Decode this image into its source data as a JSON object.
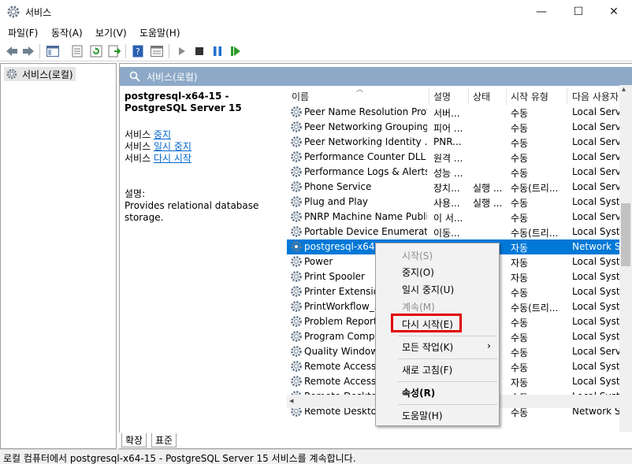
{
  "window": {
    "title": "서비스",
    "minimize": "—",
    "maximize": "☐",
    "close": "✕"
  },
  "menu": [
    "파일(F)",
    "동작(A)",
    "보기(V)",
    "도움말(H)"
  ],
  "tree": {
    "root": "서비스(로컬)"
  },
  "pane": {
    "header": "서비스(로컬)"
  },
  "details": {
    "title": "postgresql-x64-15 - PostgreSQL Server 15",
    "line1_prefix": "서비스",
    "line1_link": "중지",
    "line2_prefix": "서비스",
    "line2_link": "일시 중지",
    "line3_prefix": "서비스",
    "line3_link": "다시 시작",
    "desc_label": "설명:",
    "desc_text": "Provides relational database storage."
  },
  "columns": [
    "이름",
    "설명",
    "상태",
    "시작 유형",
    "다음 사용자"
  ],
  "rows": [
    {
      "name": "Peer Name Resolution Prot...",
      "desc": "서버...",
      "status": "",
      "start": "수동",
      "user": "Local Service"
    },
    {
      "name": "Peer Networking Grouping",
      "desc": "피어 ...",
      "status": "",
      "start": "수동",
      "user": "Local Service"
    },
    {
      "name": "Peer Networking Identity ...",
      "desc": "PNR...",
      "status": "",
      "start": "수동",
      "user": "Local Service"
    },
    {
      "name": "Performance Counter DLL ...",
      "desc": "원격 ...",
      "status": "",
      "start": "수동",
      "user": "Local Service"
    },
    {
      "name": "Performance Logs & Alerts",
      "desc": "성능 ...",
      "status": "",
      "start": "수동",
      "user": "Local Service"
    },
    {
      "name": "Phone Service",
      "desc": "장치...",
      "status": "실행 ...",
      "start": "수동(트리...",
      "user": "Local Service"
    },
    {
      "name": "Plug and Play",
      "desc": "사용...",
      "status": "실행 ...",
      "start": "수동",
      "user": "Local System"
    },
    {
      "name": "PNRP Machine Name Publi...",
      "desc": "이 서...",
      "status": "",
      "start": "수동",
      "user": "Local Service"
    },
    {
      "name": "Portable Device Enumerato...",
      "desc": "이동...",
      "status": "",
      "start": "수동(트리...",
      "user": "Local System"
    },
    {
      "name": "postgresql-x64-15",
      "desc": "",
      "status": "",
      "start": "자동",
      "user": "Network Se"
    },
    {
      "name": "Power",
      "desc": "",
      "status": "",
      "start": "자동",
      "user": "Local System"
    },
    {
      "name": "Print Spooler",
      "desc": "",
      "status": "",
      "start": "자동",
      "user": "Local System"
    },
    {
      "name": "Printer Extension",
      "desc": "",
      "status": "",
      "start": "수동",
      "user": "Local System"
    },
    {
      "name": "PrintWorkflow_3",
      "desc": "",
      "status": "",
      "start": "수동(트리...",
      "user": "Local System"
    },
    {
      "name": "Problem Reports",
      "desc": "",
      "status": "",
      "start": "수동",
      "user": "Local System"
    },
    {
      "name": "Program Compa",
      "desc": "",
      "status": "",
      "start": "수동",
      "user": "Local System"
    },
    {
      "name": "Quality Windows",
      "desc": "",
      "status": "",
      "start": "수동",
      "user": "Local Service"
    },
    {
      "name": "Remote Access A",
      "desc": "",
      "status": "",
      "start": "수동",
      "user": "Local System"
    },
    {
      "name": "Remote Access C",
      "desc": "",
      "status": "",
      "start": "자동",
      "user": "Local System"
    },
    {
      "name": "Remote Desktop",
      "desc": "",
      "status": "",
      "start": "수동",
      "user": "Local System"
    },
    {
      "name": "Remote Desktop",
      "desc": "",
      "status": "",
      "start": "수동",
      "user": "Network Se"
    }
  ],
  "context_menu": {
    "start": "시작(S)",
    "stop": "중지(O)",
    "pause": "일시 중지(U)",
    "resume": "계속(M)",
    "restart": "다시 시작(E)",
    "all_tasks": "모든 작업(K)",
    "refresh": "새로 고침(F)",
    "properties": "속성(R)",
    "help": "도움말(H)"
  },
  "tabs": [
    "확장",
    "표준"
  ],
  "status": "로컬 컴퓨터에서 postgresql-x64-15 - PostgreSQL Server 15 서비스를 계속합니다.",
  "colors": {
    "selection": "#0078d7",
    "header": "#8ea9c8",
    "highlight": "#e00000",
    "link": "#0066cc"
  }
}
